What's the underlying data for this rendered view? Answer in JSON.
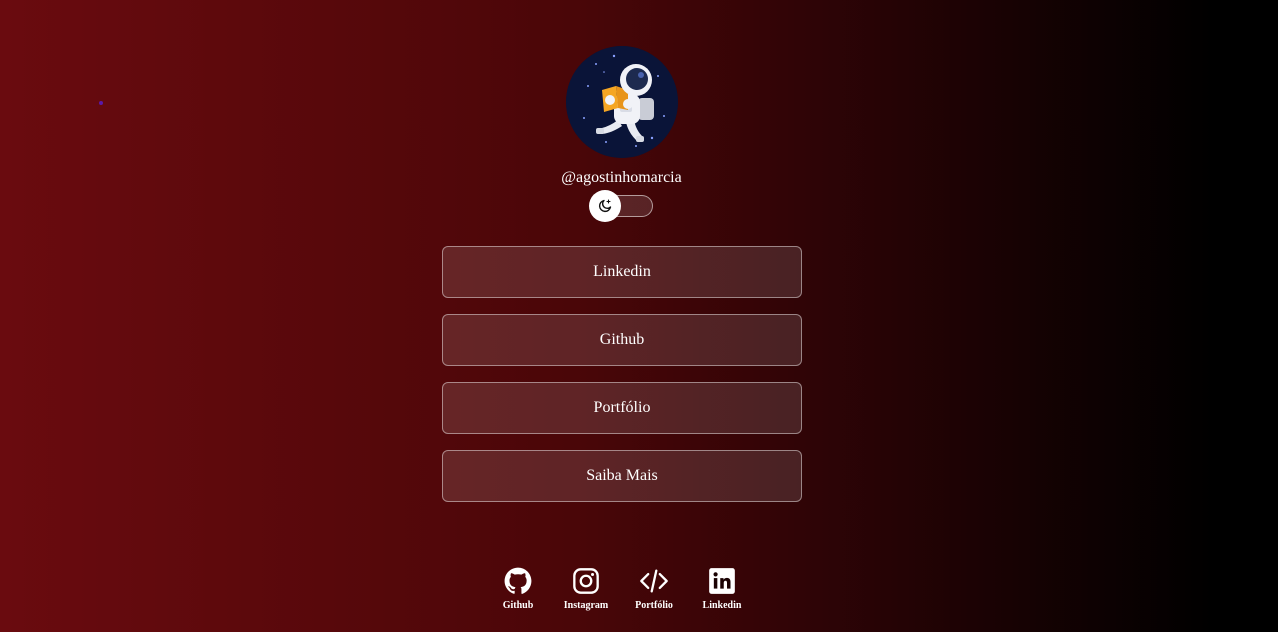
{
  "profile": {
    "avatar_icon": "astronaut-avatar",
    "handle": "@agostinhomarcia"
  },
  "theme_toggle": {
    "icon": "moon-stars-icon",
    "state": "off"
  },
  "links": [
    {
      "label": "Linkedin"
    },
    {
      "label": "Github"
    },
    {
      "label": "Portfólio"
    },
    {
      "label": "Saiba Mais"
    }
  ],
  "socials": [
    {
      "label": "Github",
      "icon": "github-icon"
    },
    {
      "label": "Instagram",
      "icon": "instagram-icon"
    },
    {
      "label": "Portfólio",
      "icon": "code-icon"
    },
    {
      "label": "Linkedin",
      "icon": "linkedin-icon"
    }
  ],
  "colors": {
    "background_start": "#6a0b0f",
    "background_end": "#000000",
    "avatar_bg": "#0a1438",
    "button_border": "rgba(255,255,255,0.45)"
  }
}
